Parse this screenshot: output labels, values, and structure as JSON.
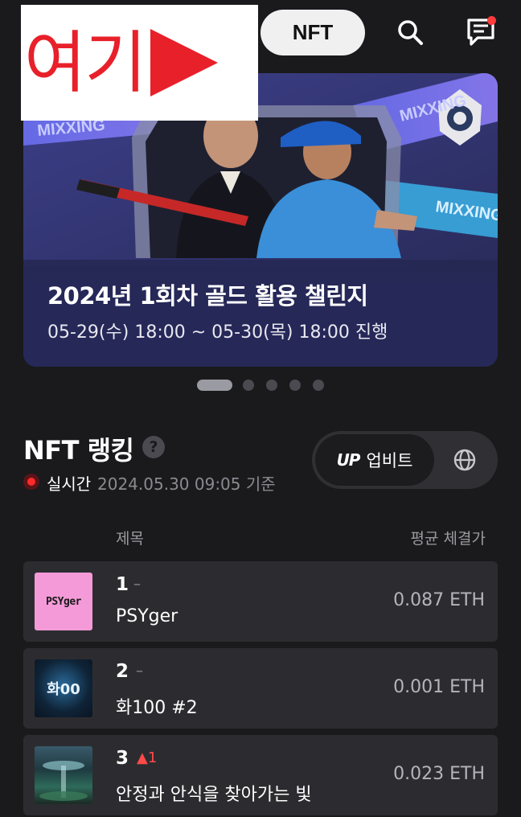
{
  "annotation": {
    "text": "여기"
  },
  "header": {
    "nft_pill": "NFT",
    "search_icon": "search-icon",
    "chat_icon": "chat-icon",
    "notification_color": "#ff3b3b"
  },
  "banner": {
    "art_text": "MIXXING",
    "title": "2024년 1회차 골드 활용 챌린지",
    "subtitle": "05-29(수) 18:00 ~ 05-30(목) 18:00 진행",
    "carousel_count": 5,
    "carousel_active_index": 0
  },
  "ranking": {
    "title": "NFT 랭킹",
    "help_icon": "?",
    "live_label": "실시간",
    "timestamp": "2024.05.30 09:05 기준",
    "exchange_label": "업비트",
    "exchange_logo": "UP",
    "columns": {
      "title": "제목",
      "price": "평균 체결가"
    },
    "rows": [
      {
        "rank": "1",
        "change": "–",
        "change_type": "flat",
        "name": "PSYger",
        "price": "0.087 ETH",
        "thumb_text": "PSYger"
      },
      {
        "rank": "2",
        "change": "–",
        "change_type": "flat",
        "name": "화100 #2",
        "price": "0.001 ETH",
        "thumb_text": "화00"
      },
      {
        "rank": "3",
        "change": "▲1",
        "change_type": "up",
        "name": "안정과 안식을 찾아가는 빛",
        "price": "0.023 ETH",
        "thumb_text": ""
      }
    ]
  },
  "colors": {
    "background": "#1a1a1d",
    "banner": "#2a2c55",
    "row": "#2c2c30",
    "accent_red": "#ff2a2a"
  }
}
